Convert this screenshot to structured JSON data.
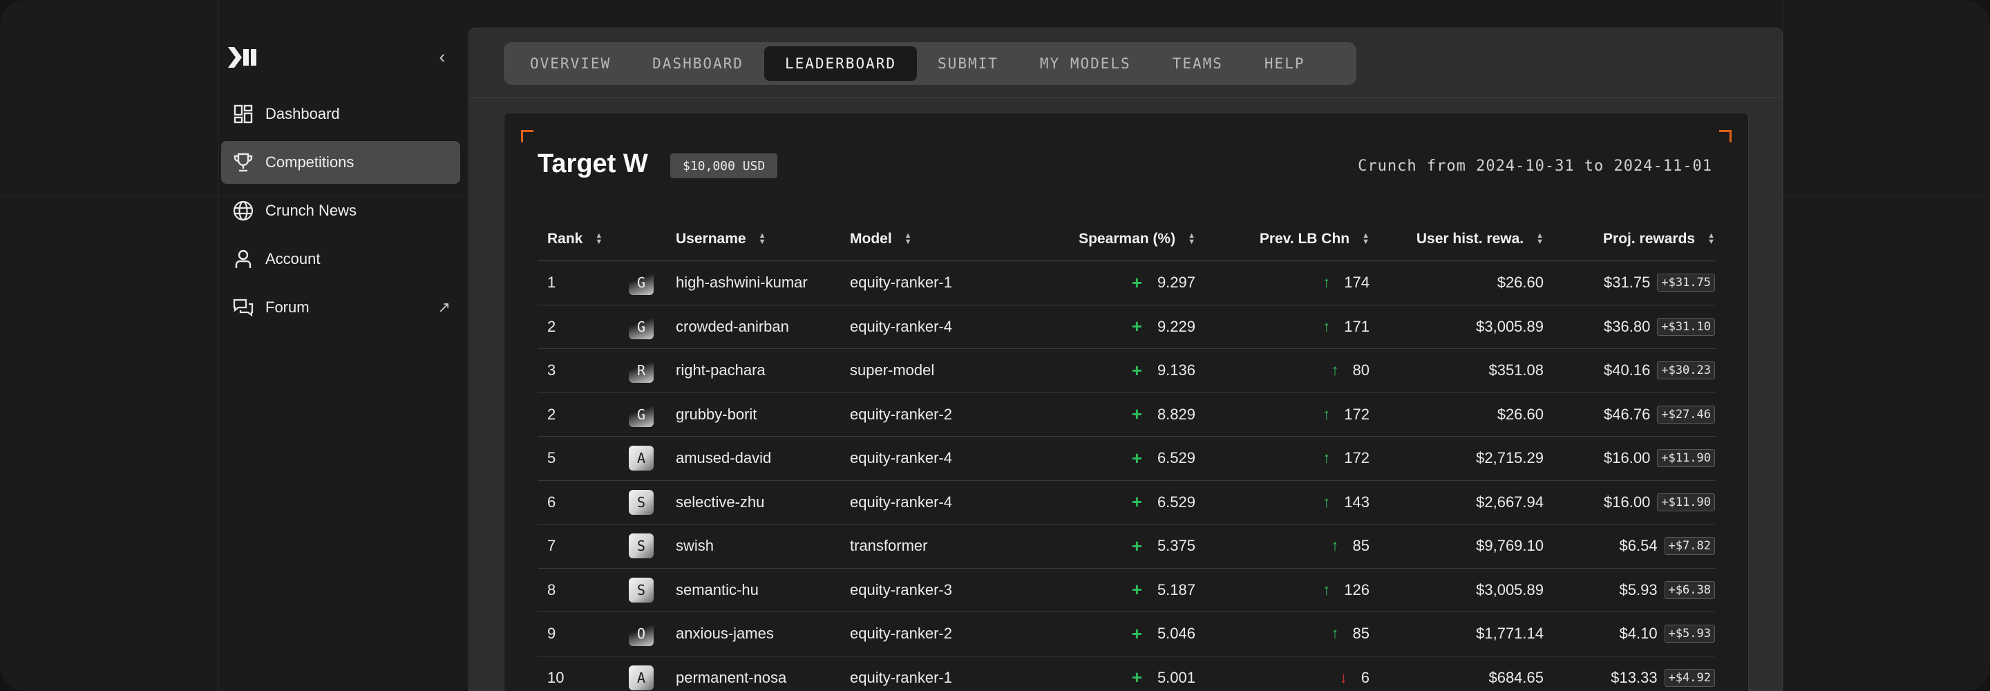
{
  "sidebar": {
    "collapse_label": "‹",
    "items": [
      {
        "label": "Dashboard",
        "icon": "dashboard-icon"
      },
      {
        "label": "Competitions",
        "icon": "trophy-icon",
        "active": true
      },
      {
        "label": "Crunch News",
        "icon": "globe-icon"
      },
      {
        "label": "Account",
        "icon": "user-icon"
      },
      {
        "label": "Forum",
        "icon": "chat-icon",
        "external": "↗"
      }
    ]
  },
  "tabs": [
    "OVERVIEW",
    "DASHBOARD",
    "LEADERBOARD",
    "SUBMIT",
    "MY MODELS",
    "TEAMS",
    "HELP"
  ],
  "active_tab": "LEADERBOARD",
  "card": {
    "title": "Target W",
    "prize": "$10,000 USD",
    "crunch_range": "Crunch from 2024-10-31 to 2024-11-01"
  },
  "table": {
    "headers": {
      "rank": "Rank",
      "username": "Username",
      "model": "Model",
      "spearman": "Spearman (%)",
      "prev": "Prev. LB Chn",
      "hist": "User hist. rewa.",
      "proj": "Proj. rewards"
    },
    "rows": [
      {
        "rank": "1",
        "avatar": "G",
        "avatar_style": "dark",
        "username": "high-ashwini-kumar",
        "model": "equity-ranker-1",
        "spearman": "9.297",
        "prev_dir": "up",
        "prev": "174",
        "hist": "$26.60",
        "proj": "$31.75",
        "delta": "+$31.75"
      },
      {
        "rank": "2",
        "avatar": "G",
        "avatar_style": "dark",
        "username": "crowded-anirban",
        "model": "equity-ranker-4",
        "spearman": "9.229",
        "prev_dir": "up",
        "prev": "171",
        "hist": "$3,005.89",
        "proj": "$36.80",
        "delta": "+$31.10"
      },
      {
        "rank": "3",
        "avatar": "R",
        "avatar_style": "dark",
        "username": "right-pachara",
        "model": "super-model",
        "spearman": "9.136",
        "prev_dir": "up",
        "prev": "80",
        "hist": "$351.08",
        "proj": "$40.16",
        "delta": "+$30.23"
      },
      {
        "rank": "2",
        "avatar": "G",
        "avatar_style": "dark",
        "username": "grubby-borit",
        "model": "equity-ranker-2",
        "spearman": "8.829",
        "prev_dir": "up",
        "prev": "172",
        "hist": "$26.60",
        "proj": "$46.76",
        "delta": "+$27.46"
      },
      {
        "rank": "5",
        "avatar": "A",
        "avatar_style": "light",
        "username": "amused-david",
        "model": "equity-ranker-4",
        "spearman": "6.529",
        "prev_dir": "up",
        "prev": "172",
        "hist": "$2,715.29",
        "proj": "$16.00",
        "delta": "+$11.90"
      },
      {
        "rank": "6",
        "avatar": "S",
        "avatar_style": "light",
        "username": "selective-zhu",
        "model": "equity-ranker-4",
        "spearman": "6.529",
        "prev_dir": "up",
        "prev": "143",
        "hist": "$2,667.94",
        "proj": "$16.00",
        "delta": "+$11.90"
      },
      {
        "rank": "7",
        "avatar": "S",
        "avatar_style": "light",
        "username": "swish",
        "model": "transformer",
        "spearman": "5.375",
        "prev_dir": "up",
        "prev": "85",
        "hist": "$9,769.10",
        "proj": "$6.54",
        "delta": "+$7.82"
      },
      {
        "rank": "8",
        "avatar": "S",
        "avatar_style": "light",
        "username": "semantic-hu",
        "model": "equity-ranker-3",
        "spearman": "5.187",
        "prev_dir": "up",
        "prev": "126",
        "hist": "$3,005.89",
        "proj": "$5.93",
        "delta": "+$6.38"
      },
      {
        "rank": "9",
        "avatar": "O",
        "avatar_style": "dark",
        "username": "anxious-james",
        "model": "equity-ranker-2",
        "spearman": "5.046",
        "prev_dir": "up",
        "prev": "85",
        "hist": "$1,771.14",
        "proj": "$4.10",
        "delta": "+$5.93"
      },
      {
        "rank": "10",
        "avatar": "A",
        "avatar_style": "light",
        "username": "permanent-nosa",
        "model": "equity-ranker-1",
        "spearman": "5.001",
        "prev_dir": "down",
        "prev": "6",
        "hist": "$684.65",
        "proj": "$13.33",
        "delta": "+$4.92"
      }
    ]
  },
  "colors": {
    "accent_corner": "#e0601a",
    "positive": "#2fbf5a",
    "negative": "#e2382f"
  }
}
